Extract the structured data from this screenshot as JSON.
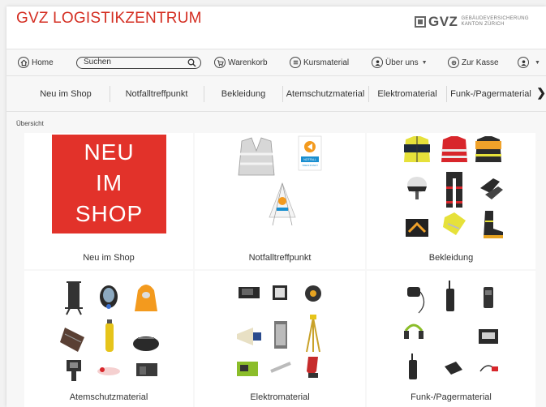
{
  "header": {
    "site_title": "GVZ LOGISTIKZENTRUM",
    "logo_text": "GVZ",
    "logo_sub_line1": "GEBÄUDEVERSICHERUNG",
    "logo_sub_line2": "KANTON ZÜRICH"
  },
  "nav": {
    "home": "Home",
    "search_placeholder": "Suchen",
    "cart": "Warenkorb",
    "course_material": "Kursmaterial",
    "about": "Über uns",
    "checkout": "Zur Kasse"
  },
  "categories": [
    "Neu im Shop",
    "Notfalltreffpunkt",
    "Bekleidung",
    "Atemschutzmaterial",
    "Elektromaterial",
    "Funk-/Pagermaterial"
  ],
  "breadcrumb": "Übersicht",
  "tiles": [
    {
      "label": "Neu im Shop",
      "banner": [
        "NEU",
        "IM",
        "SHOP"
      ]
    },
    {
      "label": "Notfalltreffpunkt",
      "sign_text": "NOTFALL TREFFPUNKT"
    },
    {
      "label": "Bekleidung"
    },
    {
      "label": "Atemschutzmaterial"
    },
    {
      "label": "Elektromaterial"
    },
    {
      "label": "Funk-/Pagermaterial"
    }
  ],
  "colors": {
    "brand_red": "#d42e22",
    "banner_red": "#e2322a",
    "accent_blue": "#1a8fd0",
    "hivis_yellow": "#e6e13a",
    "orange": "#f39a1e"
  }
}
